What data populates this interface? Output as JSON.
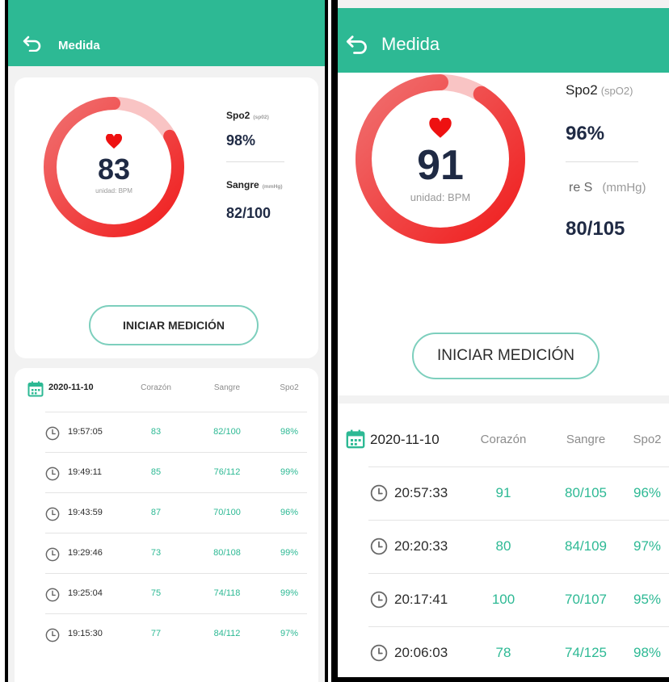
{
  "left": {
    "header": {
      "title": "Medida"
    },
    "bpm": {
      "value": "83",
      "unit": "unidad: BPM",
      "fraction": 0.83
    },
    "spo2": {
      "label": "Spo2",
      "unit": "(sp02)",
      "value": "98%"
    },
    "blood": {
      "label": "Sangre",
      "unit": "(mmHg)",
      "value": "82/100"
    },
    "start_button": "INICIAR MEDICIÓN",
    "list": {
      "date": "2020-11-10",
      "headers": [
        "Corazón",
        "Sangre",
        "Spo2"
      ],
      "rows": [
        {
          "time": "19:57:05",
          "heart": "83",
          "blood": "82/100",
          "spo2": "98%"
        },
        {
          "time": "19:49:11",
          "heart": "85",
          "blood": "76/112",
          "spo2": "99%"
        },
        {
          "time": "19:43:59",
          "heart": "87",
          "blood": "70/100",
          "spo2": "96%"
        },
        {
          "time": "19:29:46",
          "heart": "73",
          "blood": "80/108",
          "spo2": "99%"
        },
        {
          "time": "19:25:04",
          "heart": "75",
          "blood": "74/118",
          "spo2": "99%"
        },
        {
          "time": "19:15:30",
          "heart": "77",
          "blood": "84/112",
          "spo2": "97%"
        }
      ]
    }
  },
  "right": {
    "header": {
      "title": "Medida"
    },
    "bpm": {
      "value": "91",
      "unit": "unidad: BPM",
      "fraction": 0.91
    },
    "spo2": {
      "label": "Spo2",
      "unit": "(spO2)",
      "value": "96%"
    },
    "blood": {
      "label": "re S",
      "unit": "(mmHg)",
      "value": "80/105"
    },
    "start_button": "INICIAR MEDICIÓN",
    "list": {
      "date": "2020-11-10",
      "headers": [
        "Corazón",
        "Sangre",
        "Spo2"
      ],
      "rows": [
        {
          "time": "20:57:33",
          "heart": "91",
          "blood": "80/105",
          "spo2": "96%"
        },
        {
          "time": "20:20:33",
          "heart": "80",
          "blood": "84/109",
          "spo2": "97%"
        },
        {
          "time": "20:17:41",
          "heart": "100",
          "blood": "70/107",
          "spo2": "95%"
        },
        {
          "time": "20:06:03",
          "heart": "78",
          "blood": "74/125",
          "spo2": "98%"
        }
      ]
    }
  },
  "colors": {
    "accent": "#2db994",
    "ring_start": "#f01e1e",
    "ring_end": "#f7b0b0",
    "heart": "#ee1111"
  },
  "icons": [
    "back-arrow-icon",
    "heart-icon",
    "calendar-icon",
    "clock-icon"
  ]
}
